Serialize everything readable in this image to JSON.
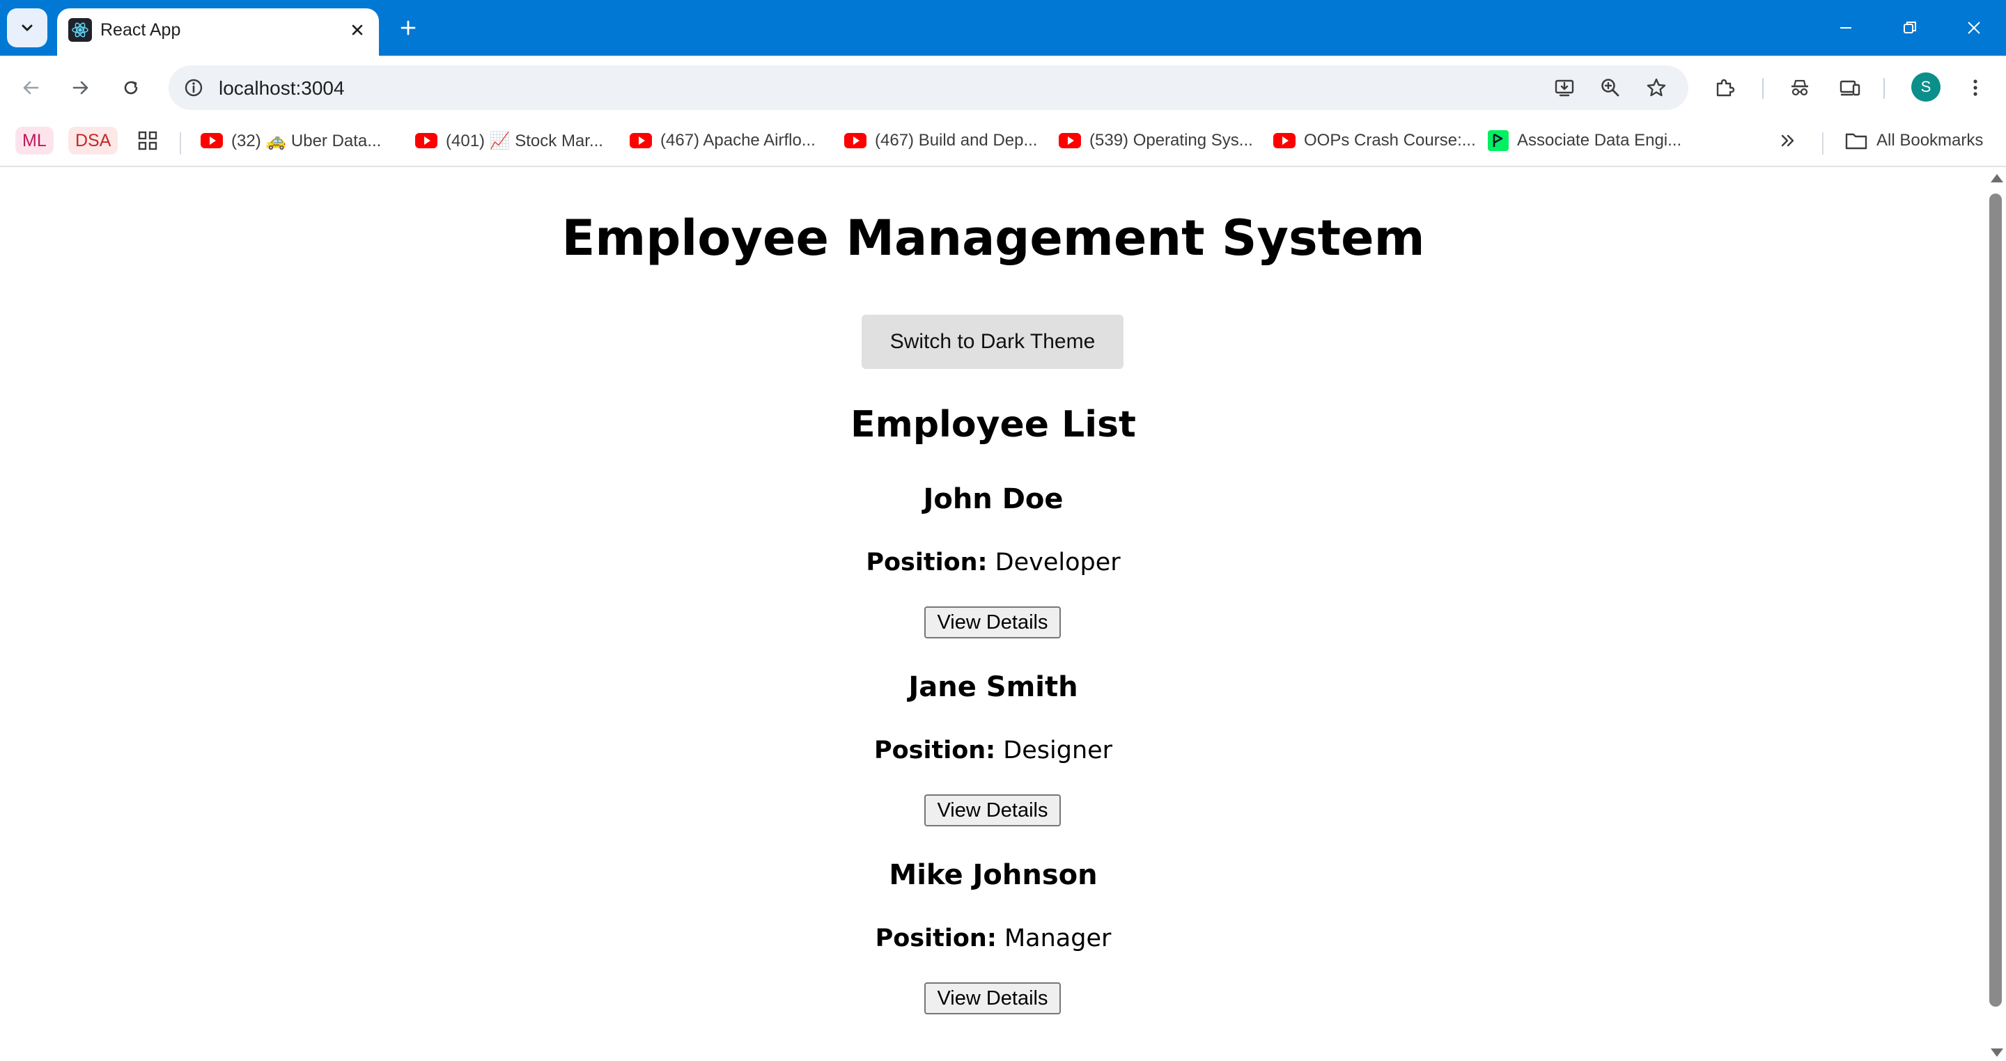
{
  "browser": {
    "tab_title": "React App",
    "url": "localhost:3004",
    "profile_initial": "S",
    "accent_color": "#0078d4"
  },
  "bookmarks": {
    "chips": [
      {
        "label": "ML",
        "color": "#c2185b",
        "bg": "#fde4ec"
      },
      {
        "label": "DSA",
        "color": "#c62828",
        "bg": "#fde7e7"
      }
    ],
    "items": [
      {
        "label": "(32) 🚕 Uber Data..."
      },
      {
        "label": "(401) 📈 Stock Mar..."
      },
      {
        "label": "(467) Apache Airflo..."
      },
      {
        "label": "(467) Build and Dep..."
      },
      {
        "label": "(539) Operating Sys..."
      },
      {
        "label": "OOPs Crash Course:..."
      },
      {
        "label": "Associate Data Engi..."
      }
    ],
    "all_bookmarks": "All Bookmarks"
  },
  "app": {
    "title": "Employee Management System",
    "theme_button": "Switch to Dark Theme",
    "list_title": "Employee List",
    "position_label": "Position:",
    "view_button": "View Details",
    "employees": [
      {
        "name": "John Doe",
        "position": "Developer"
      },
      {
        "name": "Jane Smith",
        "position": "Designer"
      },
      {
        "name": "Mike Johnson",
        "position": "Manager"
      }
    ]
  }
}
